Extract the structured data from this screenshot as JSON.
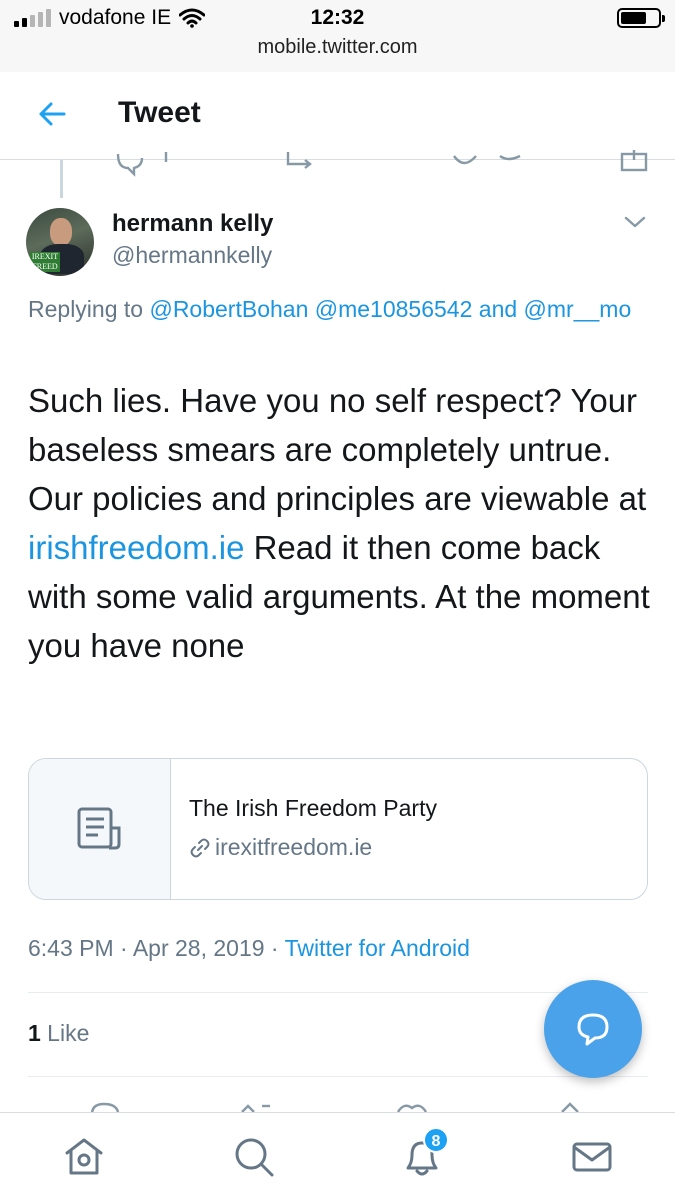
{
  "status_bar": {
    "carrier": "vodafone IE",
    "time": "12:32",
    "url": "mobile.twitter.com"
  },
  "header": {
    "title": "Tweet"
  },
  "tweet": {
    "display_name": "hermann kelly",
    "handle": "@hermannkelly",
    "avatar_banner_text": "IREXIT FREED",
    "replying_prefix": "Replying to",
    "reply_mentions": [
      "@RobertBohan",
      "@me10856542"
    ],
    "reply_and": "and",
    "reply_last_mention": "@mr__mo",
    "text_before_link": "Such lies. Have you no self respect? Your baseless smears are completely untrue. Our policies and principles are viewable at ",
    "text_link": "irishfreedom.ie",
    "text_after_link": " Read it then come back with some valid arguments. At the moment you have none",
    "timestamp": "6:43 PM · Apr 28, 2019 · ",
    "source": "Twitter for Android",
    "like_count": "1",
    "like_label": " Like"
  },
  "card": {
    "title": "The Irish Freedom Party",
    "domain": "irexitfreedom.ie",
    "icon": "document-icon"
  },
  "bottom_nav": {
    "items": [
      "home-icon",
      "search-icon",
      "notifications-icon",
      "messages-icon"
    ],
    "notification_count": "8"
  },
  "colors": {
    "link": "#1b95e0",
    "fab": "#4aa3ea",
    "badge": "#1da1f2",
    "muted_text": "#657786"
  }
}
